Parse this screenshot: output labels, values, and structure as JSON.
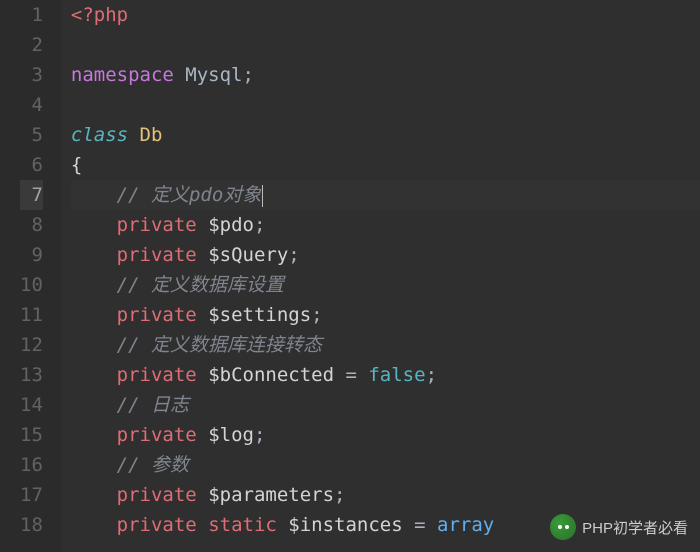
{
  "editor": {
    "activeLine": 7,
    "lines": [
      {
        "num": "1",
        "tokens": [
          {
            "t": "<?",
            "c": "kw-tag"
          },
          {
            "t": "php",
            "c": "kw-tag"
          }
        ]
      },
      {
        "num": "2",
        "tokens": []
      },
      {
        "num": "3",
        "tokens": [
          {
            "t": "namespace",
            "c": "kw-namespace"
          },
          {
            "t": " ",
            "c": ""
          },
          {
            "t": "Mysql",
            "c": "nsname"
          },
          {
            "t": ";",
            "c": "punct"
          }
        ]
      },
      {
        "num": "4",
        "tokens": []
      },
      {
        "num": "5",
        "tokens": [
          {
            "t": "class",
            "c": "kw-class"
          },
          {
            "t": " ",
            "c": ""
          },
          {
            "t": "Db",
            "c": "classname"
          }
        ]
      },
      {
        "num": "6",
        "tokens": [
          {
            "t": "{",
            "c": "brace"
          }
        ]
      },
      {
        "num": "7",
        "indent": "    ",
        "tokens": [
          {
            "t": "// 定义pdo对象",
            "c": "comment"
          }
        ],
        "cursor": true
      },
      {
        "num": "8",
        "indent": "    ",
        "tokens": [
          {
            "t": "private",
            "c": "keyword-mod"
          },
          {
            "t": " ",
            "c": ""
          },
          {
            "t": "$pdo",
            "c": "variable"
          },
          {
            "t": ";",
            "c": "punct"
          }
        ]
      },
      {
        "num": "9",
        "indent": "    ",
        "tokens": [
          {
            "t": "private",
            "c": "keyword-mod"
          },
          {
            "t": " ",
            "c": ""
          },
          {
            "t": "$sQuery",
            "c": "variable"
          },
          {
            "t": ";",
            "c": "punct"
          }
        ]
      },
      {
        "num": "10",
        "indent": "    ",
        "tokens": [
          {
            "t": "// 定义数据库设置",
            "c": "comment"
          }
        ]
      },
      {
        "num": "11",
        "indent": "    ",
        "tokens": [
          {
            "t": "private",
            "c": "keyword-mod"
          },
          {
            "t": " ",
            "c": ""
          },
          {
            "t": "$settings",
            "c": "variable"
          },
          {
            "t": ";",
            "c": "punct"
          }
        ]
      },
      {
        "num": "12",
        "indent": "    ",
        "tokens": [
          {
            "t": "// 定义数据库连接转态",
            "c": "comment"
          }
        ]
      },
      {
        "num": "13",
        "indent": "    ",
        "tokens": [
          {
            "t": "private",
            "c": "keyword-mod"
          },
          {
            "t": " ",
            "c": ""
          },
          {
            "t": "$bConnected",
            "c": "variable"
          },
          {
            "t": " = ",
            "c": "punct"
          },
          {
            "t": "false",
            "c": "bool"
          },
          {
            "t": ";",
            "c": "punct"
          }
        ]
      },
      {
        "num": "14",
        "indent": "    ",
        "tokens": [
          {
            "t": "// 日志",
            "c": "comment"
          }
        ]
      },
      {
        "num": "15",
        "indent": "    ",
        "tokens": [
          {
            "t": "private",
            "c": "keyword-mod"
          },
          {
            "t": " ",
            "c": ""
          },
          {
            "t": "$log",
            "c": "variable"
          },
          {
            "t": ";",
            "c": "punct"
          }
        ]
      },
      {
        "num": "16",
        "indent": "    ",
        "tokens": [
          {
            "t": "// 参数",
            "c": "comment"
          }
        ]
      },
      {
        "num": "17",
        "indent": "    ",
        "tokens": [
          {
            "t": "private",
            "c": "keyword-mod"
          },
          {
            "t": " ",
            "c": ""
          },
          {
            "t": "$parameters",
            "c": "variable"
          },
          {
            "t": ";",
            "c": "punct"
          }
        ]
      },
      {
        "num": "18",
        "indent": "    ",
        "tokens": [
          {
            "t": "private",
            "c": "keyword-mod"
          },
          {
            "t": " ",
            "c": ""
          },
          {
            "t": "static",
            "c": "keyword-mod"
          },
          {
            "t": " ",
            "c": ""
          },
          {
            "t": "$instances",
            "c": "variable"
          },
          {
            "t": " = ",
            "c": "punct"
          },
          {
            "t": "array",
            "c": "func"
          }
        ]
      }
    ]
  },
  "watermark": {
    "text": "PHP初学者必看"
  }
}
